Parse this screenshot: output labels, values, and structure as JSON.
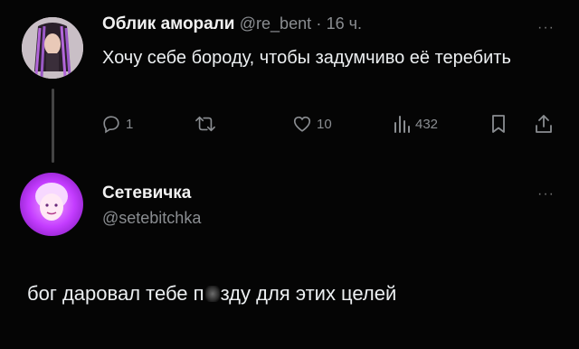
{
  "tweet": {
    "author_name": "Облик аморали",
    "handle": "@re_bent",
    "separator": "·",
    "time": "16 ч.",
    "text": "Хочу себе бороду, чтобы задумчиво её теребить",
    "more_label": "···",
    "actions": {
      "replies": "1",
      "retweets": "",
      "likes": "10",
      "views": "432"
    }
  },
  "reply": {
    "author_name": "Сетевичка",
    "handle": "@setebitchka",
    "more_label": "···",
    "text_before": "бог даровал тебе п",
    "text_after": "зду для этих целей"
  },
  "colors": {
    "background": "#050505",
    "text": "#eceff1",
    "muted": "#8a8d91",
    "thread_line": "#444444",
    "reply_avatar_accent": "#c43cff"
  },
  "icons": {
    "reply": "comment-icon",
    "retweet": "retweet-icon",
    "like": "heart-icon",
    "views": "bar-chart-icon",
    "bookmark": "bookmark-icon",
    "share": "share-icon"
  }
}
